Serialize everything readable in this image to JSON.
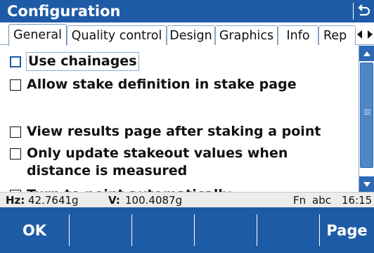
{
  "window": {
    "title": "Configuration",
    "back_icon": "return-arrow-icon"
  },
  "tabs": [
    {
      "label": "General",
      "active": true
    },
    {
      "label": "Quality control",
      "active": false
    },
    {
      "label": "Design",
      "active": false
    },
    {
      "label": "Graphics",
      "active": false
    },
    {
      "label": "Info",
      "active": false
    },
    {
      "label": "Rep",
      "active": false
    }
  ],
  "tab_nav": {
    "prev_icon": "triangle-left-icon",
    "next_icon": "triangle-right-icon"
  },
  "options": [
    {
      "label": "Use chainages",
      "checked": false,
      "focused": true
    },
    {
      "label": "Allow stake definition in stake page",
      "checked": false,
      "focused": false
    },
    {
      "label": "View results page after staking a point",
      "checked": false,
      "focused": false
    },
    {
      "label": "Only update stakeout values when distance is measured",
      "label_line1": "Only update stakeout values when",
      "label_line2": "distance is measured",
      "checked": false,
      "focused": false
    },
    {
      "label": "Turn to point automatically",
      "checked": false,
      "focused": false
    }
  ],
  "status": {
    "hz_label": "Hz:",
    "hz_value": "42.7641g",
    "v_label": "V:",
    "v_value": "100.4087g",
    "input_mode_fn": "Fn",
    "input_mode": "abc",
    "time": "16:15"
  },
  "softkeys": {
    "f1": "OK",
    "f6": "Page"
  },
  "colors": {
    "accent": "#1e5ba6",
    "status_bg": "#ececec",
    "scroll": "#2d69b4"
  }
}
